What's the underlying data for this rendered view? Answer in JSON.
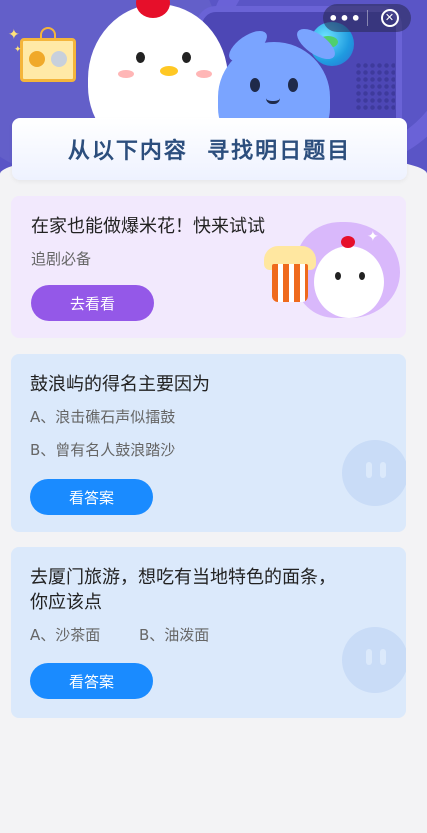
{
  "header": {
    "banner_title": "从以下内容  寻找明日题目",
    "menu_more": "•••",
    "menu_close": "✕"
  },
  "promo": {
    "title": "在家也能做爆米花！快来试试",
    "subtitle": "追剧必备",
    "button": "去看看"
  },
  "questions": [
    {
      "title": "鼓浪屿的得名主要因为",
      "options": [
        "A、浪击礁石声似擂鼓",
        "B、曾有名人鼓浪踏沙"
      ],
      "button": "看答案"
    },
    {
      "title_line1": "去厦门旅游，想吃有当地特色的面条，",
      "title_line2": "你应该点",
      "options": [
        "A、沙茶面",
        "B、油泼面"
      ],
      "button": "看答案"
    }
  ],
  "colors": {
    "banner": "#5a55c6",
    "promo_bg": "#f2e9fd",
    "promo_button": "#9458e8",
    "question_bg": "#dbe9fb",
    "answer_button": "#1a8bff"
  }
}
